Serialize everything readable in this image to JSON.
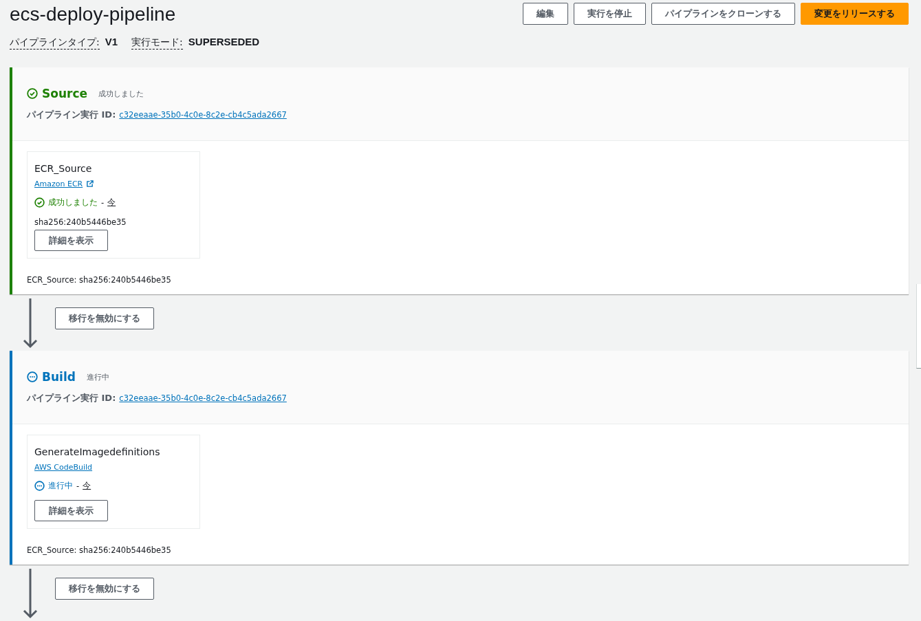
{
  "pipeline": {
    "title": "ecs-deploy-pipeline",
    "meta": [
      {
        "label": "パイプラインタイプ:",
        "value": "V1"
      },
      {
        "label": "実行モード:",
        "value": "SUPERSEDED"
      }
    ]
  },
  "buttons": [
    {
      "label": "編集",
      "primary": false
    },
    {
      "label": "実行を停止",
      "primary": false
    },
    {
      "label": "パイプラインをクローンする",
      "primary": false
    },
    {
      "label": "変更をリリースする",
      "primary": true
    }
  ],
  "stages": [
    {
      "name": "Source",
      "kind": "succeeded",
      "status_text": "成功しました",
      "execution_label": "パイプライン実行 ID:",
      "execution_id": "c32eeaae-35b0-4c0e-8c2e-cb4c5ada2667",
      "actions": [
        {
          "name": "ECR_Source",
          "provider": "Amazon ECR",
          "external": true,
          "kind": "succeeded",
          "status_text": "成功しました",
          "separator": "-",
          "time": "今",
          "detail": "sha256:240b5446be35",
          "button": "詳細を表示"
        }
      ],
      "artifact": "ECR_Source: sha256:240b5446be35",
      "transition": {
        "button": "移行を無効にする"
      }
    },
    {
      "name": "Build",
      "kind": "in_progress",
      "status_text": "進行中",
      "execution_label": "パイプライン実行 ID:",
      "execution_id": "c32eeaae-35b0-4c0e-8c2e-cb4c5ada2667",
      "actions": [
        {
          "name": "GenerateImagedefinitions",
          "provider": "AWS CodeBuild",
          "external": false,
          "kind": "in_progress",
          "status_text": "進行中",
          "separator": "-",
          "time": "今",
          "button": "詳細を表示"
        }
      ],
      "artifact": "ECR_Source: sha256:240b5446be35",
      "transition": {
        "button": "移行を無効にする"
      }
    }
  ]
}
